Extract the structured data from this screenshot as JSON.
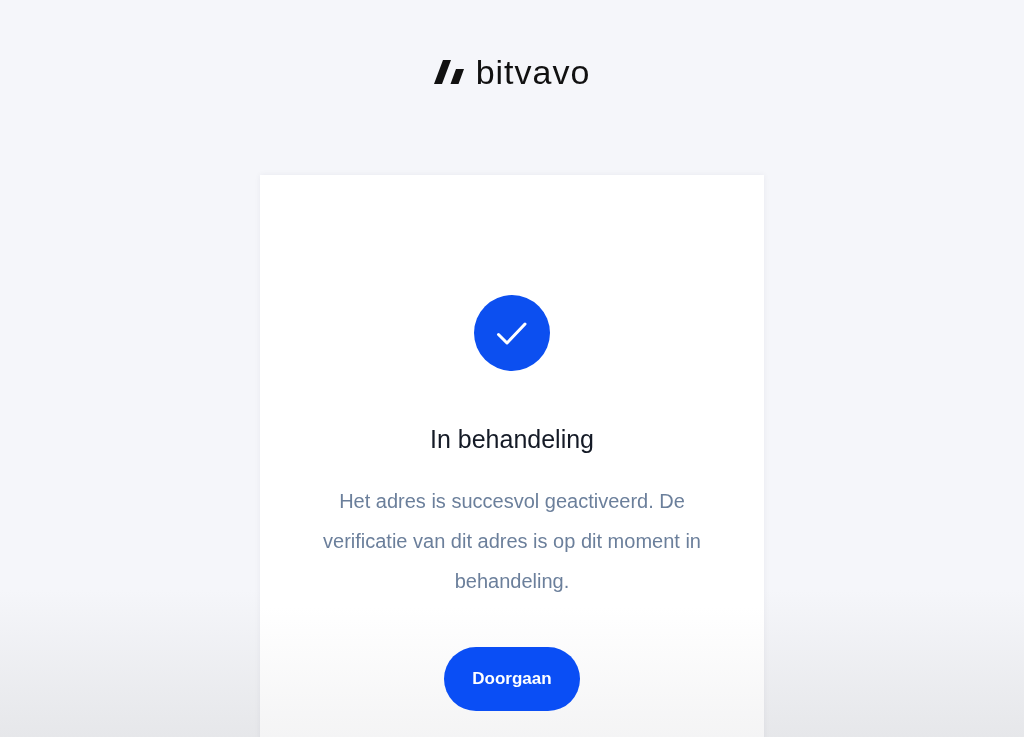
{
  "header": {
    "logo_text": "bitvavo"
  },
  "card": {
    "title": "In behandeling",
    "message": "Het adres is succesvol geactiveerd. De verificatie van dit adres is op dit moment in behandeling.",
    "button": "Doorgaan"
  }
}
